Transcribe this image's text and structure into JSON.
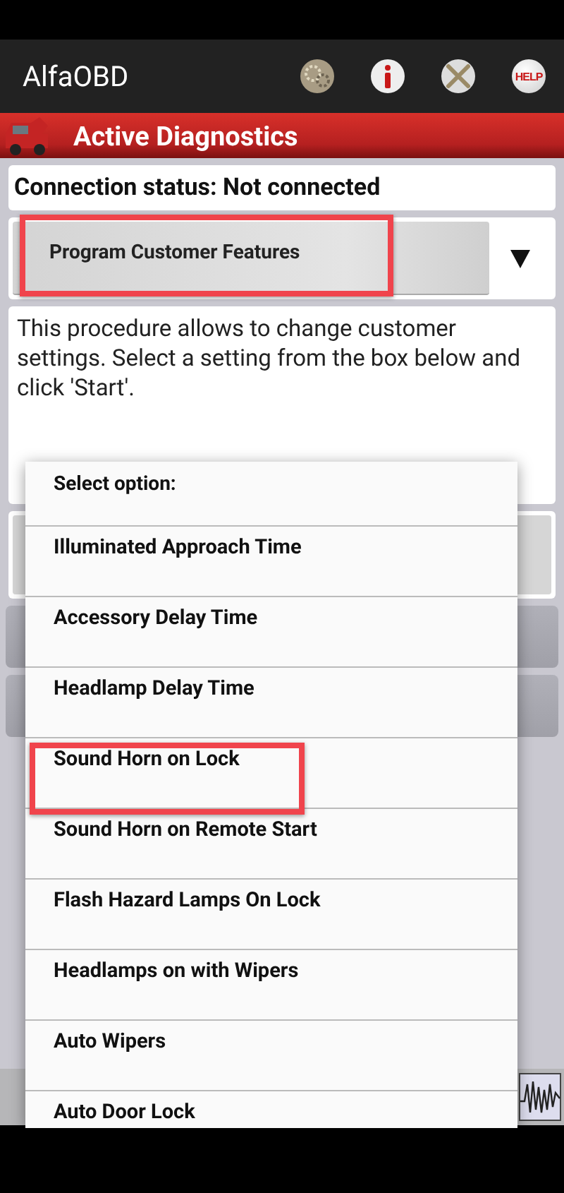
{
  "app_bar": {
    "title": "AlfaOBD",
    "help_label": "HELP"
  },
  "header": {
    "title": "Active Diagnostics"
  },
  "connection_status": "Connection status: Not connected",
  "procedure_spinner": {
    "value": "Program Customer Features",
    "highlighted": true
  },
  "description": "This procedure allows to change customer settings. Select a setting from the box below and click 'Start'.",
  "option_dialog": {
    "title": "Select option:",
    "options": [
      {
        "label": "Illuminated Approach Time",
        "highlighted": false
      },
      {
        "label": "Accessory Delay Time",
        "highlighted": false
      },
      {
        "label": "Headlamp Delay Time",
        "highlighted": false
      },
      {
        "label": "Sound Horn on Lock",
        "highlighted": true
      },
      {
        "label": "Sound Horn on Remote Start",
        "highlighted": false
      },
      {
        "label": "Flash Hazard Lamps On Lock",
        "highlighted": false
      },
      {
        "label": "Headlamps on with Wipers",
        "highlighted": false
      },
      {
        "label": "Auto Wipers",
        "highlighted": false
      },
      {
        "label": "Auto Door Lock",
        "highlighted": false
      }
    ]
  }
}
